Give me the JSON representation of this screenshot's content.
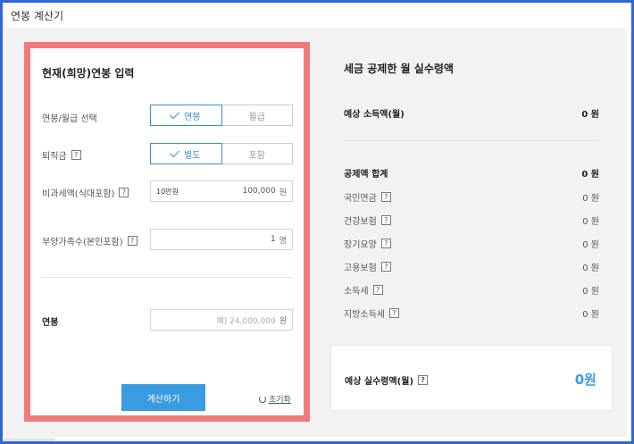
{
  "header": {
    "title": "연봉 계산기"
  },
  "input": {
    "section_title": "현재(희망)연봉 입력",
    "salary_type": {
      "label": "연봉/월급 선택",
      "options": [
        "연봉",
        "월급"
      ],
      "selected": "연봉"
    },
    "severance": {
      "label": "퇴직금",
      "help": "?",
      "options": [
        "별도",
        "포함"
      ],
      "selected": "별도"
    },
    "nontaxable": {
      "label": "비과세액(식대포함)",
      "help": "?",
      "prefix": "10만원",
      "value": "100,000",
      "unit": "원"
    },
    "dependents": {
      "label": "부양가족수(본인포함)",
      "help": "?",
      "value": "1",
      "unit": "명"
    },
    "salary": {
      "label": "연봉",
      "placeholder": "예) 24,000,000",
      "unit": "원"
    },
    "calculate_label": "계산하기",
    "reset_label": "초기화"
  },
  "result": {
    "title": "세금 공제한 월 실수령액",
    "expected_income": {
      "label": "예상 소득액(월)",
      "value": "0 원"
    },
    "deduction_total": {
      "label": "공제액 합계",
      "value": "0 원"
    },
    "deductions": [
      {
        "label": "국민연금",
        "value": "0 원"
      },
      {
        "label": "건강보험",
        "value": "0 원"
      },
      {
        "label": "장기요양",
        "value": "0 원"
      },
      {
        "label": "고용보험",
        "value": "0 원"
      },
      {
        "label": "소득세",
        "value": "0 원"
      },
      {
        "label": "지방소득세",
        "value": "0 원"
      }
    ],
    "net_pay": {
      "label": "예상 실수령액(월)",
      "help": "?",
      "value": "0원"
    }
  },
  "colors": {
    "accent": "#3b9be0",
    "highlight_border": "#f27a79",
    "frame": "#2f67d8"
  }
}
